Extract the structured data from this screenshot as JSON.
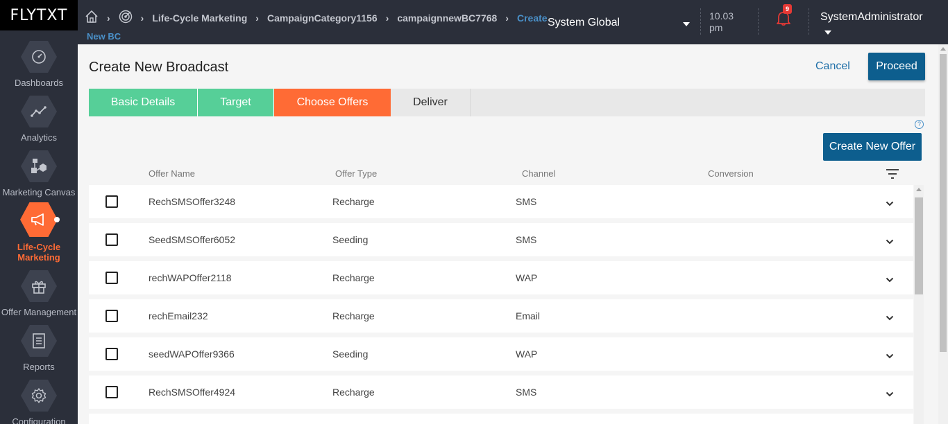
{
  "brand": {
    "logo_text": "FLYTXT"
  },
  "sidebar": {
    "items": [
      {
        "label": "Dashboards",
        "icon": "gauge-icon"
      },
      {
        "label": "Analytics",
        "icon": "line-chart-icon"
      },
      {
        "label": "Marketing Canvas",
        "icon": "canvas-icon"
      },
      {
        "label": "Life-Cycle Marketing",
        "icon": "megaphone-icon",
        "active": true
      },
      {
        "label": "Offer Management",
        "icon": "gift-icon"
      },
      {
        "label": "Reports",
        "icon": "report-icon"
      },
      {
        "label": "Configuration",
        "icon": "gear-icon"
      }
    ]
  },
  "header": {
    "breadcrumb": [
      "Life-Cycle Marketing",
      "CampaignCategory1156",
      "campaignnewBC7768",
      "Create"
    ],
    "breadcrumb_sub": "New BC",
    "context": "System Global",
    "time": "10.03",
    "time_suffix": "pm",
    "notification_count": "9",
    "user": "SystemAdministrator"
  },
  "page": {
    "title": "Create New Broadcast",
    "cancel_label": "Cancel",
    "proceed_label": "Proceed",
    "help": "?",
    "create_offer_label": "Create New Offer"
  },
  "steps": [
    {
      "label": "Basic Details",
      "state": "done"
    },
    {
      "label": "Target",
      "state": "done"
    },
    {
      "label": "Choose Offers",
      "state": "active"
    },
    {
      "label": "Deliver",
      "state": "pending"
    }
  ],
  "table": {
    "columns": [
      "Offer Name",
      "Offer Type",
      "Channel",
      "Conversion"
    ],
    "rows": [
      {
        "name": "RechSMSOffer3248",
        "type": "Recharge",
        "channel": "SMS"
      },
      {
        "name": "SeedSMSOffer6052",
        "type": "Seeding",
        "channel": "SMS"
      },
      {
        "name": "rechWAPOffer2118",
        "type": "Recharge",
        "channel": "WAP"
      },
      {
        "name": "rechEmail232",
        "type": "Recharge",
        "channel": "Email"
      },
      {
        "name": "seedWAPOffer9366",
        "type": "Seeding",
        "channel": "WAP"
      },
      {
        "name": "RechSMSOffer4924",
        "type": "Recharge",
        "channel": "SMS"
      }
    ]
  },
  "colors": {
    "accent": "#ff6b35",
    "primary": "#0d5e8e",
    "done": "#56cf98",
    "sidebar": "#2b2f3a"
  }
}
